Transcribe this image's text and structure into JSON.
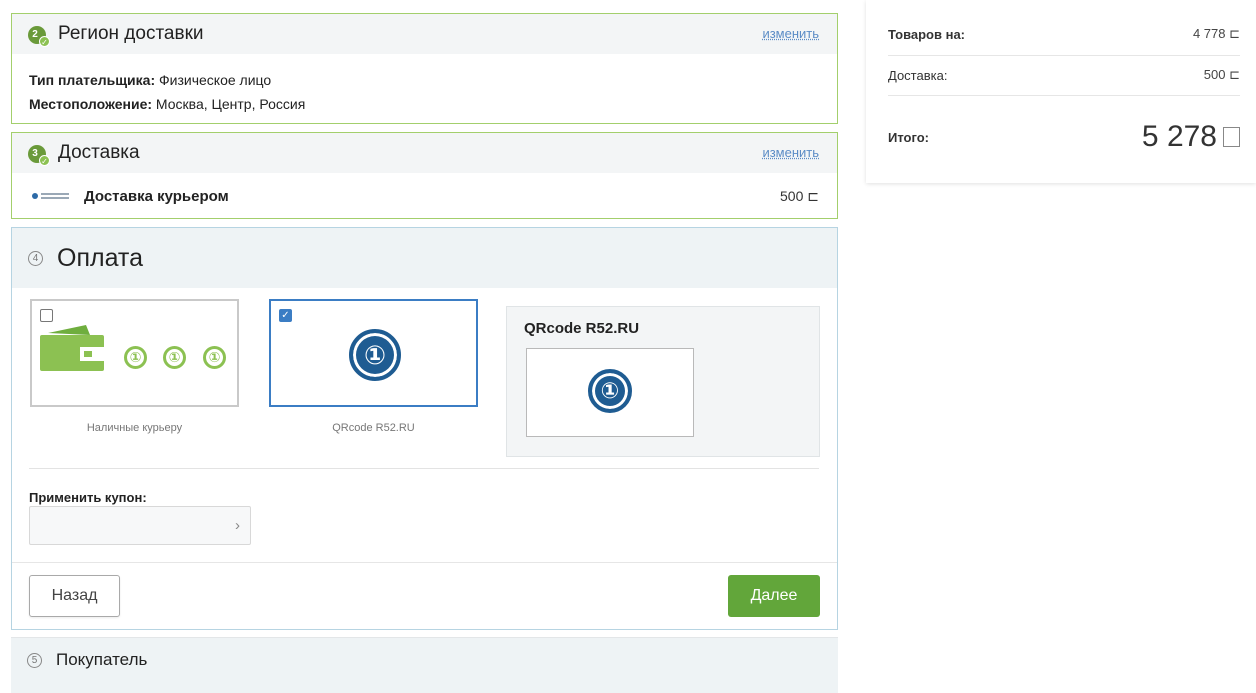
{
  "region": {
    "title": "Регион доставки",
    "step": "2",
    "change": "изменить",
    "payer_label": "Тип плательщика:",
    "payer_value": " Физическое лицо",
    "location_label": "Местоположение:",
    "location_value": " Москва, Центр, Россия"
  },
  "delivery": {
    "title": "Доставка",
    "step": "3",
    "change": "изменить",
    "method": "Доставка курьером",
    "price": "500 ⊏"
  },
  "payment": {
    "step": "4",
    "title": "Оплата",
    "options": [
      {
        "label": "Наличные курьеру",
        "checked": false,
        "coin": "①"
      },
      {
        "label": "QRcode R52.RU",
        "checked": true,
        "coin": "①"
      }
    ],
    "panel_title": "QRcode R52.RU",
    "checkmark": "✓",
    "coupon_label": "Применить купон:",
    "coupon_placeholder": "",
    "arrow": "›",
    "back": "Назад",
    "next": "Далее"
  },
  "buyer": {
    "step": "5",
    "title": "Покупатель"
  },
  "summary": {
    "goods_label": "Товаров на:",
    "goods_value": "4 778 ⊏",
    "delivery_label": "Доставка:",
    "delivery_value": "500 ⊏",
    "total_label": "Итого:",
    "total_value": "5 278"
  },
  "colors": {
    "accent_green": "#62a63a",
    "link_blue": "#5b8cc6",
    "selected_blue": "#3b7dc4",
    "coin_navy": "#1f5c92"
  }
}
